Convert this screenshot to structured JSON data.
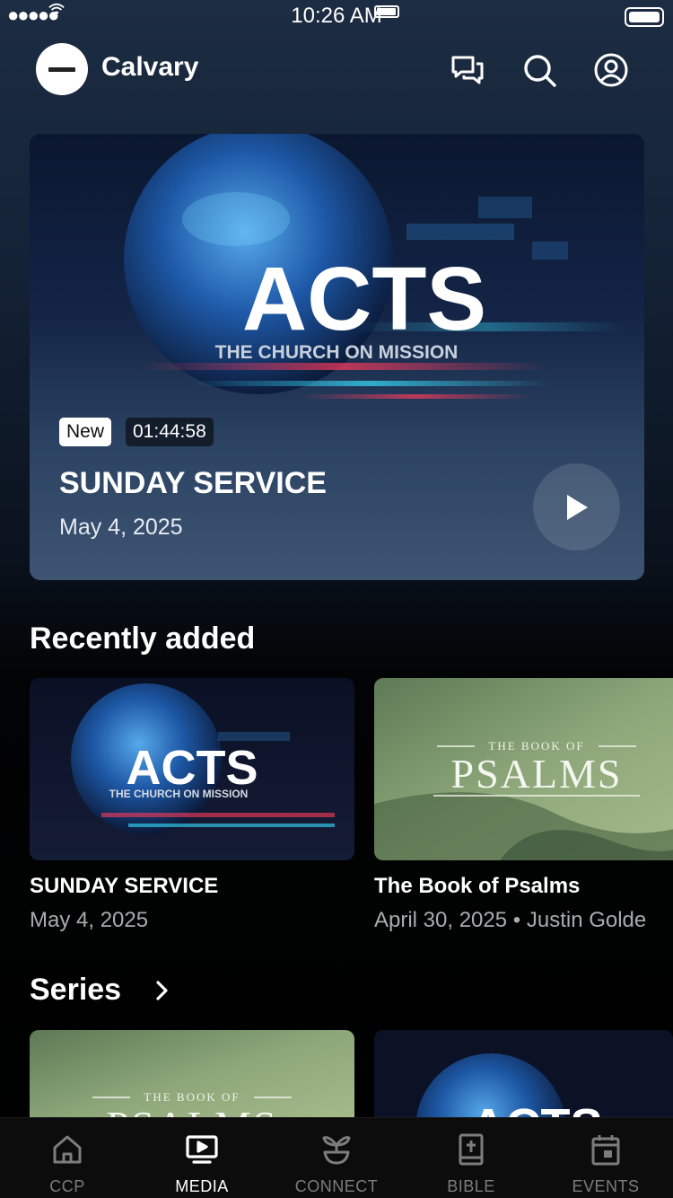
{
  "status_bar": {
    "signal": "●●●●●",
    "time": "10:26 AM"
  },
  "header": {
    "app_title": "Calvary",
    "icons": [
      "chat-icon",
      "search-icon",
      "profile-icon"
    ]
  },
  "hero": {
    "artwork_title": "ACTS",
    "artwork_subtitle": "THE CHURCH ON MISSION",
    "badge": "New",
    "duration": "01:44:58",
    "title": "SUNDAY SERVICE",
    "date": "May 4, 2025"
  },
  "recently_added": {
    "title": "Recently added",
    "items": [
      {
        "art_title": "ACTS",
        "art_subtitle": "THE CHURCH ON MISSION",
        "title": "SUNDAY SERVICE",
        "subtitle": "May 4, 2025"
      },
      {
        "art_kicker": "THE BOOK OF",
        "art_title": "PSALMS",
        "title": "The Book of Psalms",
        "subtitle": "April 30, 2025 • Justin Golde"
      }
    ]
  },
  "series": {
    "title": "Series",
    "items": [
      {
        "art_kicker": "THE BOOK OF",
        "art_title": "PSALMS"
      },
      {
        "art_title": "ACTS"
      }
    ]
  },
  "tab_bar": {
    "tabs": [
      {
        "label": "CCP",
        "icon": "home-icon",
        "active": false
      },
      {
        "label": "MEDIA",
        "icon": "tv-play-icon",
        "active": true
      },
      {
        "label": "CONNECT",
        "icon": "sprout-icon",
        "active": false
      },
      {
        "label": "BIBLE",
        "icon": "bible-icon",
        "active": false
      },
      {
        "label": "EVENTS",
        "icon": "calendar-icon",
        "active": false
      }
    ]
  },
  "colors": {
    "background_top": "#1c2c42",
    "background_bottom": "#000000",
    "tab_active": "#ffffff",
    "tab_inactive": "#7d7d7d",
    "subtitle_gray": "#a8abb0"
  }
}
